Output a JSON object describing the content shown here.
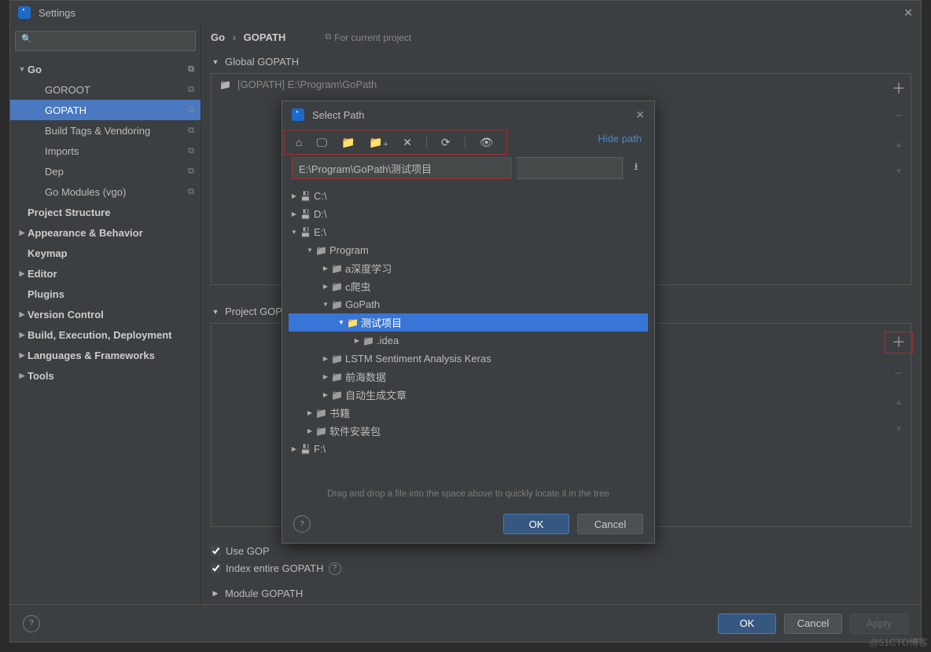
{
  "window": {
    "title": "Settings",
    "close_x": "✕"
  },
  "search": {
    "placeholder": ""
  },
  "sidebar": {
    "items": [
      {
        "label": "Go",
        "depth": 0,
        "arrow": "down",
        "bold": true,
        "copy": true
      },
      {
        "label": "GOROOT",
        "depth": 1,
        "copy": true
      },
      {
        "label": "GOPATH",
        "depth": 1,
        "selected": true,
        "copy": true
      },
      {
        "label": "Build Tags & Vendoring",
        "depth": 1,
        "copy": true
      },
      {
        "label": "Imports",
        "depth": 1,
        "copy": true
      },
      {
        "label": "Dep",
        "depth": 1,
        "copy": true
      },
      {
        "label": "Go Modules (vgo)",
        "depth": 1,
        "copy": true
      },
      {
        "label": "Project Structure",
        "depth": 0,
        "bold": true
      },
      {
        "label": "Appearance & Behavior",
        "depth": 0,
        "arrow": "right",
        "bold": true
      },
      {
        "label": "Keymap",
        "depth": 0,
        "bold": true
      },
      {
        "label": "Editor",
        "depth": 0,
        "arrow": "right",
        "bold": true
      },
      {
        "label": "Plugins",
        "depth": 0,
        "bold": true
      },
      {
        "label": "Version Control",
        "depth": 0,
        "arrow": "right",
        "bold": true
      },
      {
        "label": "Build, Execution, Deployment",
        "depth": 0,
        "arrow": "right",
        "bold": true
      },
      {
        "label": "Languages & Frameworks",
        "depth": 0,
        "arrow": "right",
        "bold": true
      },
      {
        "label": "Tools",
        "depth": 0,
        "arrow": "right",
        "bold": true
      }
    ]
  },
  "breadcrumb": {
    "part1": "Go",
    "sep": "›",
    "part2": "GOPATH"
  },
  "for_project": "For current project",
  "global_header": "Global GOPATH",
  "global_row": "[GOPATH] E:\\Program\\GoPath",
  "project_header": "Project GOPATH",
  "use_gopath": "Use GOPATH that's defined in system environment",
  "use_gopath_short": "Use GOP",
  "index_gopath": "Index entire GOPATH",
  "module_header": "Module GOPATH",
  "buttons": {
    "ok": "OK",
    "cancel": "Cancel",
    "apply": "Apply"
  },
  "dialog": {
    "title": "Select Path",
    "close_x": "✕",
    "hide_path": "Hide path",
    "path_value": "E:\\Program\\GoPath\\测试项目",
    "drag_hint": "Drag and drop a file into the space above to quickly locate it in the tree",
    "ok": "OK",
    "cancel": "Cancel",
    "toolbar_icons": {
      "home": "⌂",
      "desktop": "🖵",
      "folder": "📁",
      "new_folder": "📁₊",
      "delete": "✕",
      "refresh": "⟳",
      "show_hidden": "👁"
    },
    "tree": [
      {
        "label": "C:\\",
        "depth": 0,
        "arrow": "right",
        "icon": "drive"
      },
      {
        "label": "D:\\",
        "depth": 0,
        "arrow": "right",
        "icon": "drive"
      },
      {
        "label": "E:\\",
        "depth": 0,
        "arrow": "down",
        "icon": "drive"
      },
      {
        "label": "Program",
        "depth": 1,
        "arrow": "down",
        "icon": "folder"
      },
      {
        "label": "a深度学习",
        "depth": 2,
        "arrow": "right",
        "icon": "folder"
      },
      {
        "label": "c爬虫",
        "depth": 2,
        "arrow": "right",
        "icon": "folder"
      },
      {
        "label": "GoPath",
        "depth": 2,
        "arrow": "down",
        "icon": "folder"
      },
      {
        "label": "测试项目",
        "depth": 3,
        "arrow": "down",
        "icon": "folder",
        "selected": true
      },
      {
        "label": ".idea",
        "depth": 4,
        "arrow": "right",
        "icon": "folder"
      },
      {
        "label": "LSTM Sentiment Analysis  Keras",
        "depth": 2,
        "arrow": "right",
        "icon": "folder"
      },
      {
        "label": "前海数据",
        "depth": 2,
        "arrow": "right",
        "icon": "folder"
      },
      {
        "label": "自动生成文章",
        "depth": 2,
        "arrow": "right",
        "icon": "folder"
      },
      {
        "label": "书籍",
        "depth": 1,
        "arrow": "right",
        "icon": "folder"
      },
      {
        "label": "软件安装包",
        "depth": 1,
        "arrow": "right",
        "icon": "folder"
      },
      {
        "label": "F:\\",
        "depth": 0,
        "arrow": "right",
        "icon": "drive"
      }
    ]
  },
  "watermark": "@51CTO博客"
}
